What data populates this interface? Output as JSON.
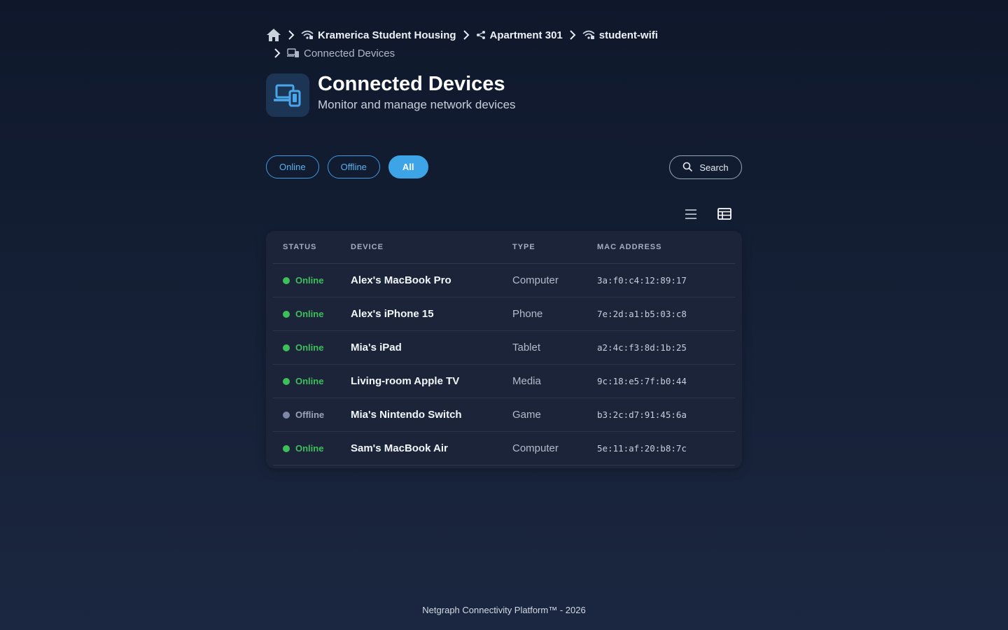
{
  "breadcrumb": {
    "items": [
      {
        "label": "Kramerica Student Housing",
        "icon": "wifi-icon"
      },
      {
        "label": "Apartment 301",
        "icon": "network-icon"
      },
      {
        "label": "student-wifi",
        "icon": "wifi-icon"
      }
    ],
    "current": {
      "label": "Connected Devices",
      "icon": "devices-icon"
    }
  },
  "header": {
    "title": "Connected Devices",
    "subtitle": "Monitor and manage network devices",
    "icon": "devices-icon"
  },
  "filters": {
    "online": "Online",
    "offline": "Offline",
    "all": "All",
    "active": "All"
  },
  "search": {
    "label": "Search"
  },
  "table": {
    "columns": {
      "status": "STATUS",
      "device": "DEVICE",
      "type": "TYPE",
      "mac": "MAC ADDRESS"
    },
    "rows": [
      {
        "status": "Online",
        "device": "Alex's MacBook Pro",
        "type": "Computer",
        "mac": "3a:f0:c4:12:89:17"
      },
      {
        "status": "Online",
        "device": "Alex's iPhone 15",
        "type": "Phone",
        "mac": "7e:2d:a1:b5:03:c8"
      },
      {
        "status": "Online",
        "device": "Mia's iPad",
        "type": "Tablet",
        "mac": "a2:4c:f3:8d:1b:25"
      },
      {
        "status": "Online",
        "device": "Living-room Apple TV",
        "type": "Media",
        "mac": "9c:18:e5:7f:b0:44"
      },
      {
        "status": "Offline",
        "device": "Mia's Nintendo Switch",
        "type": "Game",
        "mac": "b3:2c:d7:91:45:6a"
      },
      {
        "status": "Online",
        "device": "Sam's MacBook Air",
        "type": "Computer",
        "mac": "5e:11:af:20:b8:7c"
      }
    ]
  },
  "colors": {
    "accent": "#3ea4e8",
    "online": "#3fbf5a",
    "offline": "#7d88a6"
  },
  "footer": {
    "text": "Netgraph Connectivity Platform™ - 2026"
  }
}
